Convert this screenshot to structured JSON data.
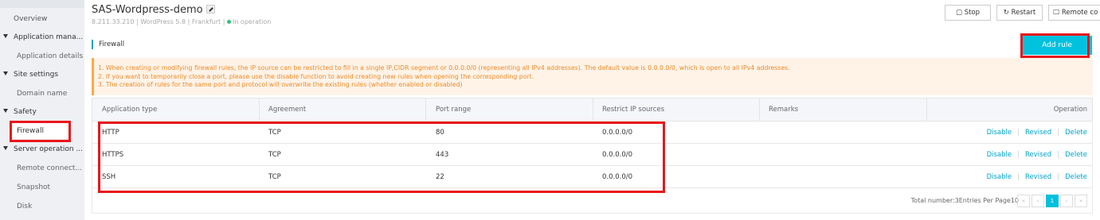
{
  "sidebar": {
    "items": [
      {
        "label": "Overview",
        "kind": "l0"
      },
      {
        "label": "Application mana...",
        "kind": "grp"
      },
      {
        "label": "Application details",
        "kind": "sub"
      },
      {
        "label": "Site settings",
        "kind": "grp"
      },
      {
        "label": "Domain name",
        "kind": "sub"
      },
      {
        "label": "Safety",
        "kind": "grp"
      },
      {
        "label": "Firewall",
        "kind": "active"
      },
      {
        "label": "Server operation ...",
        "kind": "grp"
      },
      {
        "label": "Remote connect...",
        "kind": "sub"
      },
      {
        "label": "Snapshot",
        "kind": "sub"
      },
      {
        "label": "Disk",
        "kind": "sub"
      }
    ]
  },
  "header": {
    "title": "SAS-Wordpress-demo",
    "ip": "8.211.33.210",
    "image": "WordPress 5.8",
    "region": "Frankfurt",
    "status": "In operation",
    "stop_label": "Stop",
    "restart_label": "Restart",
    "remote_label": "Remote co"
  },
  "section": {
    "title": "Firewall",
    "add_label": "Add rule"
  },
  "notice": {
    "lines": [
      "1. When creating or modifying firewall rules, the IP source can be restricted to fill in a single IP,CIDR segment or 0.0.0.0/0 (representing all IPv4 addresses). The default value is 0.0.0.0/0, which is open to all IPv4 addresses.",
      "2. If you want to temporarily close a port, please use the disable function to avoid creating new rules when opening the corresponding port.",
      "3. The creation of rules for the same port and protocol will overwrite the existing rules (whether enabled or disabled)"
    ]
  },
  "table": {
    "columns": [
      "Application type",
      "Agreement",
      "Port range",
      "Restrict IP sources",
      "Remarks",
      "Operation"
    ],
    "rows": [
      {
        "type": "HTTP",
        "agreement": "TCP",
        "port": "80",
        "ip": "0.0.0.0/0",
        "remarks": ""
      },
      {
        "type": "HTTPS",
        "agreement": "TCP",
        "port": "443",
        "ip": "0.0.0.0/0",
        "remarks": ""
      },
      {
        "type": "SSH",
        "agreement": "TCP",
        "port": "22",
        "ip": "0.0.0.0/0",
        "remarks": ""
      }
    ],
    "ops": {
      "disable": "Disable",
      "revised": "Revised",
      "delete": "Delete"
    }
  },
  "footer": {
    "total_text": "Total number:3Entries Per Page10",
    "pager": [
      "«",
      "‹",
      "1",
      "›",
      "»"
    ],
    "current_page": "1"
  },
  "colors": {
    "accent": "#00c1de",
    "link": "#00a2ca",
    "highlight": "#e8161b",
    "notice_text": "#f08a24"
  }
}
